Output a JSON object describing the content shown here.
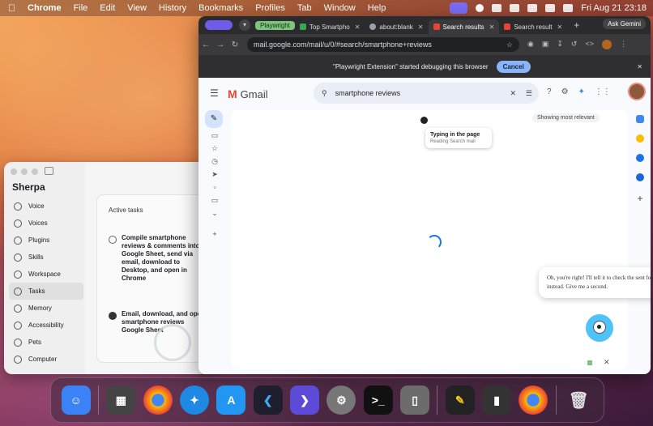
{
  "menubar": {
    "app": "Chrome",
    "items": [
      "File",
      "Edit",
      "View",
      "History",
      "Bookmarks",
      "Profiles",
      "Tab",
      "Window",
      "Help"
    ],
    "clock": "Fri Aug 21  23:18"
  },
  "sherpa": {
    "title": "Sherpa",
    "nav": [
      "Voice",
      "Voices",
      "Plugins",
      "Skills",
      "Workspace",
      "Tasks",
      "Memory",
      "Accessibility",
      "Pets",
      "Computer"
    ],
    "active_nav": "Tasks",
    "panel_title": "Active tasks",
    "tasks": [
      {
        "text": "Compile smartphone reviews & comments into Google Sheet, send via email, download to Desktop, and open in Chrome",
        "done": false
      },
      {
        "text": "Email, download, and open smartphone reviews Google Sheet",
        "done": true
      }
    ]
  },
  "chrome": {
    "tab_group": "Playwright",
    "tabs": [
      {
        "title": "Top Smartpho",
        "favicon": "sheets",
        "active": false
      },
      {
        "title": "about:blank",
        "favicon": "globe",
        "active": false
      },
      {
        "title": "Search results",
        "favicon": "gmail",
        "active": true
      },
      {
        "title": "Search result",
        "favicon": "gmail",
        "active": false
      }
    ],
    "gemini_label": "Ask Gemini",
    "url": "mail.google.com/mail/u/0/#search/smartphone+reviews",
    "infobar_message": "\"Playwright Extension\" started debugging this browser",
    "cancel_label": "Cancel"
  },
  "gmail": {
    "logo_text": "Gmail",
    "search_value": "smartphone reviews",
    "sort_label": "Showing most relevant",
    "tooltip_title": "Typing in the page",
    "tooltip_sub": "Reading Search mail",
    "chat_message": "Oh, you're right! I'll tell it to check the sent folder instead. Give me a second."
  },
  "dock": {
    "apps": [
      "Finder",
      "Launchpad",
      "Chrome",
      "Safari",
      "App Store",
      "VS Code",
      "Shortcuts",
      "System Settings",
      "Terminal",
      "Simulator",
      "Sherpa",
      "Voice Memos",
      "Chrome",
      "Trash"
    ]
  },
  "colors": {
    "accent_blue": "#8ab4f8",
    "tab_group_green": "#7ec47e",
    "gmail_red": "#ea4335"
  }
}
